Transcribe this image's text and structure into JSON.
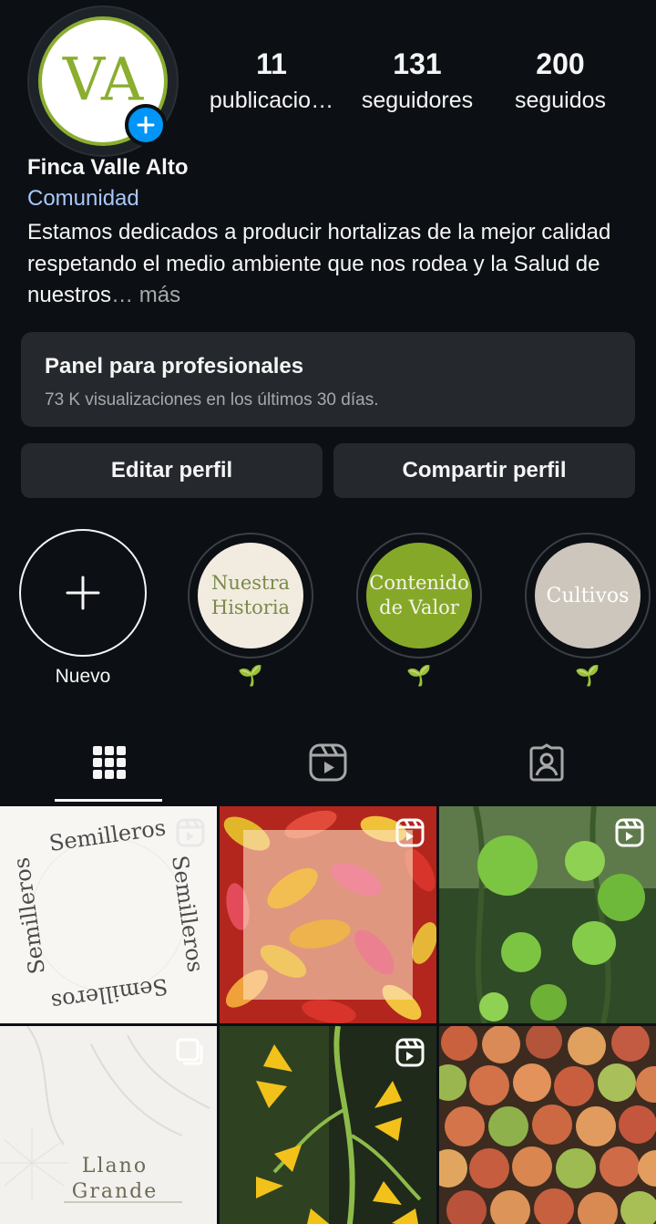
{
  "profile": {
    "avatar_monogram": "VA",
    "name": "Finca Valle Alto",
    "category": "Comunidad",
    "bio": "Estamos dedicados a producir hortalizas de la mejor calidad respetando el medio ambiente que nos rodea y la Salud de nuestros",
    "bio_more": "… más",
    "brand_color": "#8bae2f"
  },
  "stats": [
    {
      "value": "11",
      "label": "publicacio…"
    },
    {
      "value": "131",
      "label": "seguidores"
    },
    {
      "value": "200",
      "label": "seguidos"
    }
  ],
  "panel": {
    "title": "Panel para profesionales",
    "subtitle": "73 K visualizaciones en los últimos 30 días."
  },
  "buttons": {
    "edit": "Editar perfil",
    "share": "Compartir perfil"
  },
  "highlights": {
    "new_label": "Nuevo",
    "items": [
      {
        "line1": "Nuestra",
        "line2": "Historia",
        "label": "🌱"
      },
      {
        "line1": "Contenido",
        "line2": "de Valor",
        "label": "🌱"
      },
      {
        "line1": "Cultivos",
        "line2": "",
        "label": "🌱"
      }
    ]
  },
  "tabs": [
    {
      "icon": "grid-icon",
      "active": true
    },
    {
      "icon": "reels-icon",
      "active": false
    },
    {
      "icon": "tagged-icon",
      "active": false
    }
  ],
  "posts": [
    {
      "kind": "reel",
      "text": "Semilleros"
    },
    {
      "kind": "reel",
      "text": ""
    },
    {
      "kind": "reel",
      "text": ""
    },
    {
      "kind": "carousel",
      "line1": "Llano",
      "line2": "Grande"
    },
    {
      "kind": "reel",
      "text": ""
    },
    {
      "kind": "image",
      "text": ""
    }
  ]
}
